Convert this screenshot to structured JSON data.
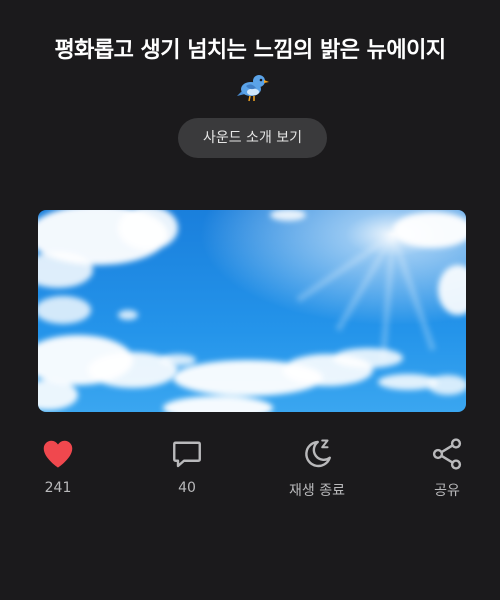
{
  "header": {
    "title": "평화롭고 생기 넘치는 느낌의 밝은 뉴에이지",
    "emoji_icon": "bird-icon"
  },
  "sound_intro_button": {
    "label": "사운드 소개 보기"
  },
  "cover_image": {
    "subject": "blue sky with white clouds"
  },
  "actions": {
    "like": {
      "icon": "heart-icon",
      "count": "241",
      "color": "#f0484e"
    },
    "comment": {
      "icon": "comment-icon",
      "count": "40"
    },
    "sleep_timer": {
      "icon": "moon-sleep-icon",
      "label": "재생 종료"
    },
    "share": {
      "icon": "share-icon",
      "label": "공유"
    }
  },
  "colors": {
    "background": "#1b1a1c",
    "button_bg": "#3a3a3c",
    "sky_blue": "#1e8ee6"
  }
}
